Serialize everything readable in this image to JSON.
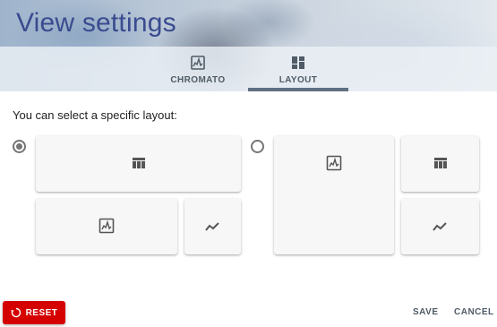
{
  "header": {
    "title": "View settings",
    "tabs": [
      {
        "label": "CHROMATO",
        "icon": "image-icon",
        "active": false
      },
      {
        "label": "LAYOUT",
        "icon": "dashboard-icon",
        "active": true
      }
    ]
  },
  "main": {
    "subtitle": "You can select a specific layout:",
    "layouts": [
      {
        "selected": true,
        "panels": [
          "table-icon",
          "image-icon",
          "chart-line-icon"
        ]
      },
      {
        "selected": false,
        "panels": [
          "image-icon",
          "table-icon",
          "chart-line-icon"
        ]
      }
    ]
  },
  "footer": {
    "reset_label": "RESET",
    "save_label": "SAVE",
    "cancel_label": "CANCEL"
  },
  "colors": {
    "title": "#3a4b8f",
    "reset": "#d50000",
    "tab_indicator": "#5f7183",
    "card": "#f7f7f7"
  }
}
